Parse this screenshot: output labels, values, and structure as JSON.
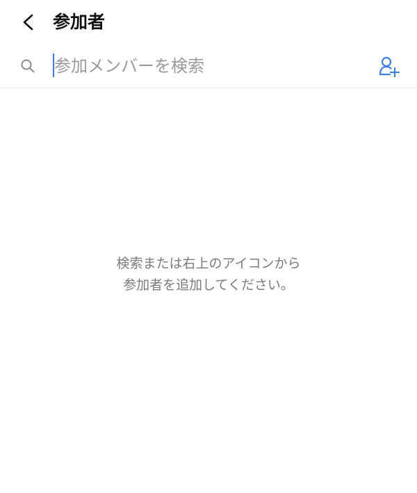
{
  "header": {
    "back_icon": "chevron-left-icon",
    "title": "参加者"
  },
  "search": {
    "icon": "search-icon",
    "placeholder": "参加メンバーを検索",
    "value": "",
    "add_member_icon": "add-person-icon",
    "accent_color": "#3f7de0"
  },
  "empty_state": {
    "line1": "検索または右上のアイコンから",
    "line2": "参加者を追加してください。"
  }
}
